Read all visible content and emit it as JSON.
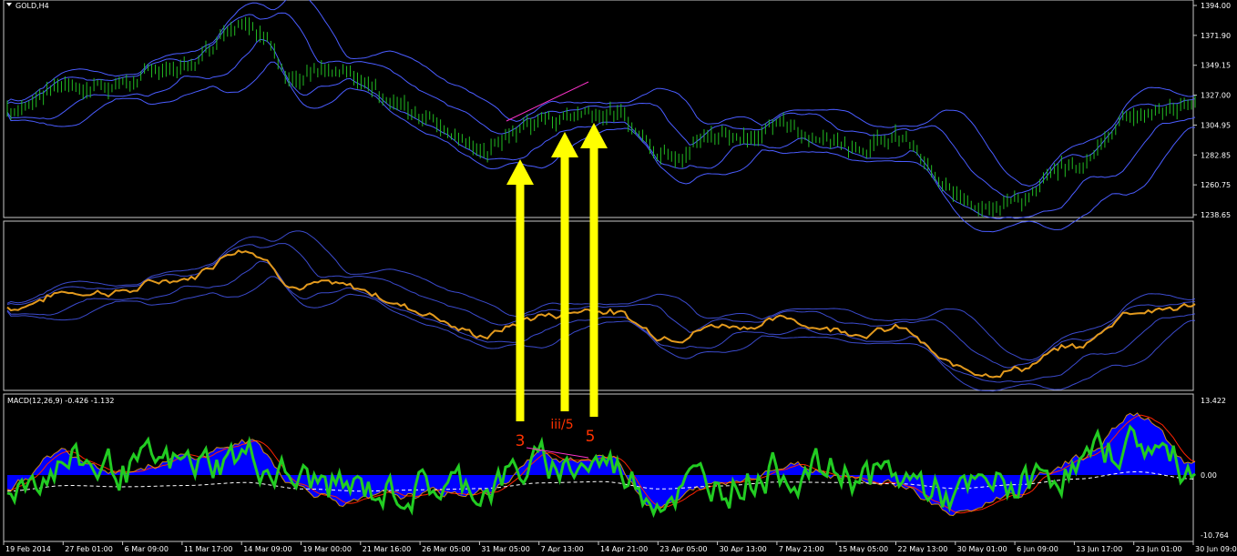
{
  "window": {
    "symbol_title": "GOLD,H4"
  },
  "colors": {
    "background": "#000000",
    "panel_border": "#c8c8c8",
    "axis_text": "#ffffff",
    "price_bars": "#22bb22",
    "bands": "#4a5cff",
    "line_close": "#e39a1e",
    "macd_hist": "#0000ff",
    "macd_signal_green": "#22cc22",
    "macd_red": "#ff2200",
    "macd_white_dash": "#ffffff",
    "arrows": "#ffff00",
    "wave_labels": "#ff3300",
    "wave_label_iii": "#ff3300",
    "trendline": "#ff33cc"
  },
  "price_axis": {
    "ticks": [
      "1394.00",
      "1371.90",
      "1349.15",
      "1327.00",
      "1304.95",
      "1282.85",
      "1260.75",
      "1238.65"
    ]
  },
  "macd_panel": {
    "label": "MACD(12,26,9) -0.426 -1.132",
    "ticks": [
      "13.422",
      "0.00",
      "-10.764"
    ]
  },
  "time_axis": {
    "ticks": [
      "19 Feb 2014",
      "27 Feb 01:00",
      "6 Mar 09:00",
      "11 Mar 17:00",
      "14 Mar 09:00",
      "19 Mar 00:00",
      "21 Mar 16:00",
      "26 Mar 05:00",
      "31 Mar 05:00",
      "7 Apr 13:00",
      "14 Apr 21:00",
      "23 Apr 05:00",
      "30 Apr 13:00",
      "7 May 21:00",
      "15 May 05:00",
      "22 May 13:00",
      "30 May 01:00",
      "6 Jun 09:00",
      "13 Jun 17:00",
      "23 Jun 01:00",
      "30 Jun 09:00"
    ]
  },
  "annotations": {
    "wave_labels": [
      "3",
      "iii/5",
      "5"
    ]
  },
  "chart_data": [
    {
      "type": "line",
      "panel": "price",
      "title": "GOLD,H4",
      "ylim": [
        1238.65,
        1394.0
      ],
      "x": [
        "19 Feb 2014",
        "27 Feb 01:00",
        "6 Mar 09:00",
        "11 Mar 17:00",
        "14 Mar 09:00",
        "19 Mar 00:00",
        "21 Mar 16:00",
        "26 Mar 05:00",
        "31 Mar 05:00",
        "7 Apr 13:00",
        "14 Apr 21:00",
        "23 Apr 05:00",
        "30 Apr 13:00",
        "7 May 21:00",
        "15 May 05:00",
        "22 May 13:00",
        "30 May 01:00",
        "6 Jun 09:00",
        "13 Jun 17:00",
        "23 Jun 01:00",
        "30 Jun 09:00"
      ],
      "series": [
        {
          "values": [
            1318,
            1336,
            1338,
            1350,
            1388,
            1343,
            1333,
            1316,
            1288,
            1308,
            1320,
            1290,
            1300,
            1304,
            1296,
            1295,
            1249,
            1254,
            1272,
            1318,
            1320
          ]
        }
      ]
    },
    {
      "type": "line",
      "panel": "macd",
      "ylim": [
        -10.764,
        13.422
      ],
      "x": [
        "19 Feb 2014",
        "27 Feb 01:00",
        "6 Mar 09:00",
        "11 Mar 17:00",
        "14 Mar 09:00",
        "19 Mar 00:00",
        "21 Mar 16:00",
        "26 Mar 05:00",
        "31 Mar 05:00",
        "7 Apr 13:00",
        "14 Apr 21:00",
        "23 Apr 05:00",
        "30 Apr 13:00",
        "7 May 21:00",
        "15 May 05:00",
        "22 May 13:00",
        "30 May 01:00",
        "6 Jun 09:00",
        "13 Jun 17:00",
        "23 Jun 01:00",
        "30 Jun 09:00"
      ],
      "series": [
        {
          "values": [
            -2,
            4,
            2,
            3,
            6,
            -2,
            -5,
            -4,
            -3,
            3,
            4,
            -5,
            -2,
            2,
            1,
            -1,
            -7,
            -3,
            3,
            11,
            2
          ]
        }
      ]
    }
  ]
}
